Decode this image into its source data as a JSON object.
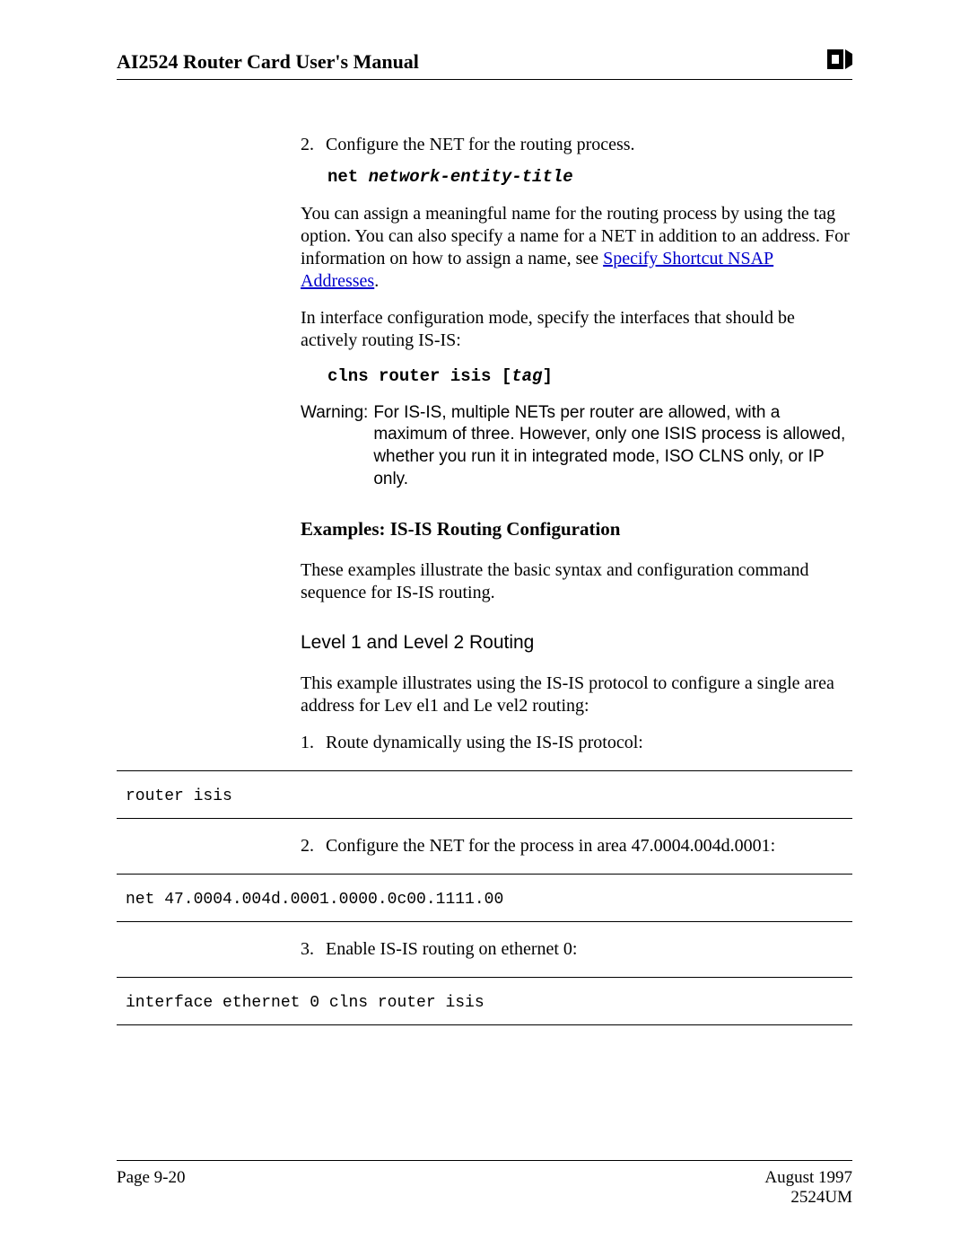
{
  "header": {
    "title": "AI2524 Router Card User's Manual"
  },
  "body": {
    "step2": {
      "num": "2.",
      "text": "Configure the NET for the routing process."
    },
    "code1_a": "net ",
    "code1_b": "network-entity-title",
    "para1_a": "You can assign a meaningful name for the routing process by using the tag option. You can also specify a name for a NET in addition to an address. For information on how to assign a name, see ",
    "para1_link": "Specify Shortcut NSAP Addresses",
    "para1_b": ".",
    "para2": "In interface configuration mode, specify the interfaces that should be actively routing IS-IS:",
    "code2_a": "clns router isis [",
    "code2_b": "tag",
    "code2_c": "]",
    "warning_label": "Warning:",
    "warning_text": "For IS-IS, multiple NETs per router are allowed, with a maximum of three. However, only one ISIS process is allowed, whether you run it in integrated mode, ISO CLNS only, or IP only.",
    "heading1": "Examples: IS-IS Routing Configuration",
    "para3": "These examples illustrate the basic syntax and configuration command sequence for IS-IS routing.",
    "heading2": "Level 1 and Level 2 Routing",
    "para4": "This example illustrates using the IS-IS protocol to configure a single area address for Lev el1 and Le vel2 routing:",
    "ex_step1": {
      "num": "1.",
      "text": "Route dynamically using the IS-IS protocol:"
    },
    "codeblock1": "router isis",
    "ex_step2": {
      "num": "2.",
      "text": "Configure the NET for the process in area 47.0004.004d.0001:"
    },
    "codeblock2": "net 47.0004.004d.0001.0000.0c00.1111.00",
    "ex_step3": {
      "num": "3.",
      "text": "Enable IS-IS routing on ethernet 0:"
    },
    "codeblock3": "interface ethernet 0 clns router isis"
  },
  "footer": {
    "page": "Page 9-20",
    "date": "August 1997",
    "docnum": "2524UM"
  }
}
